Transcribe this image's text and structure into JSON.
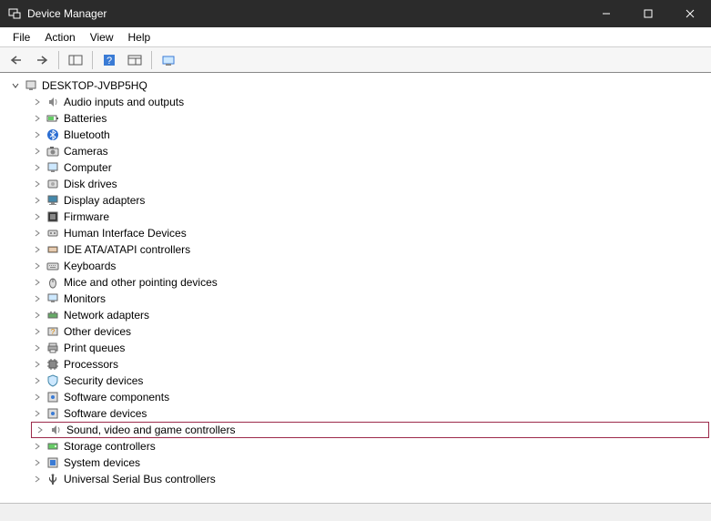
{
  "window": {
    "title": "Device Manager"
  },
  "menubar": {
    "file": "File",
    "action": "Action",
    "view": "View",
    "help": "Help"
  },
  "tree": {
    "root": "DESKTOP-JVBP5HQ",
    "items": [
      "Audio inputs and outputs",
      "Batteries",
      "Bluetooth",
      "Cameras",
      "Computer",
      "Disk drives",
      "Display adapters",
      "Firmware",
      "Human Interface Devices",
      "IDE ATA/ATAPI controllers",
      "Keyboards",
      "Mice and other pointing devices",
      "Monitors",
      "Network adapters",
      "Other devices",
      "Print queues",
      "Processors",
      "Security devices",
      "Software components",
      "Software devices",
      "Sound, video and game controllers",
      "Storage controllers",
      "System devices",
      "Universal Serial Bus controllers"
    ],
    "highlighted_index": 20
  }
}
